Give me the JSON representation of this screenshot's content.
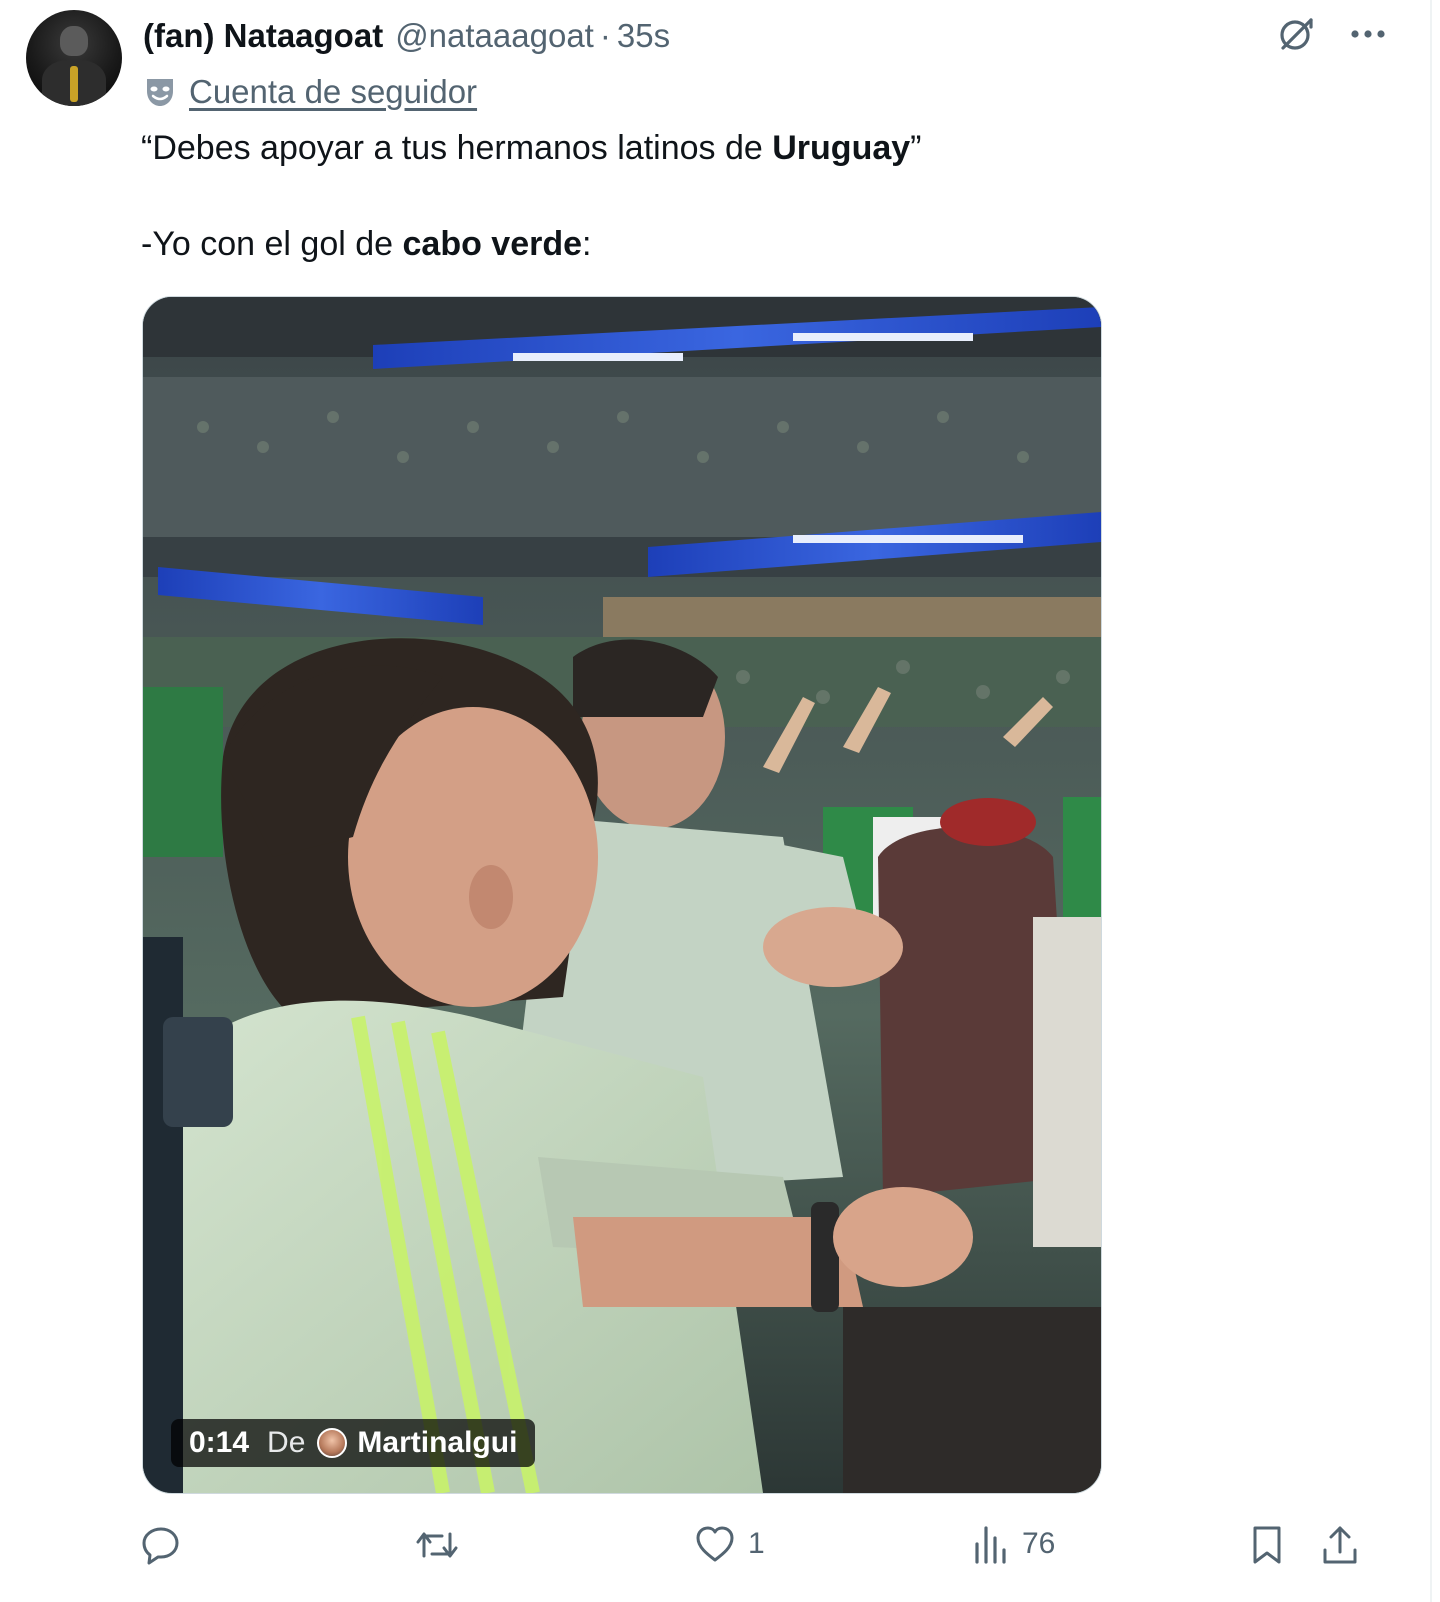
{
  "author": {
    "display_name": "(fan) Nataagoat",
    "handle": "@nataaagoat",
    "separator": "·",
    "time": "35s",
    "account_label": "Cuenta de seguidor"
  },
  "tweet": {
    "line1_pre": "“Debes apoyar a tus hermanos latinos de ",
    "line1_bold": "Uruguay",
    "line1_post": "”",
    "line2_pre": "-Yo con el gol de ",
    "line2_bold": "cabo verde",
    "line2_post": ":"
  },
  "video": {
    "duration": "0:14",
    "from_label": "De",
    "source_user": "Martinalgui"
  },
  "actions": {
    "replies": "",
    "reposts": "",
    "likes": "1",
    "views": "76"
  },
  "colors": {
    "text_primary": "#0f1419",
    "text_secondary": "#536471",
    "border": "#eff3f4"
  },
  "icons": {
    "grok": "grok-icon",
    "more": "more-icon",
    "parody": "parody-mask-icon",
    "reply": "reply-icon",
    "repost": "repost-icon",
    "like": "heart-icon",
    "views": "views-icon",
    "bookmark": "bookmark-icon",
    "share": "share-icon"
  }
}
